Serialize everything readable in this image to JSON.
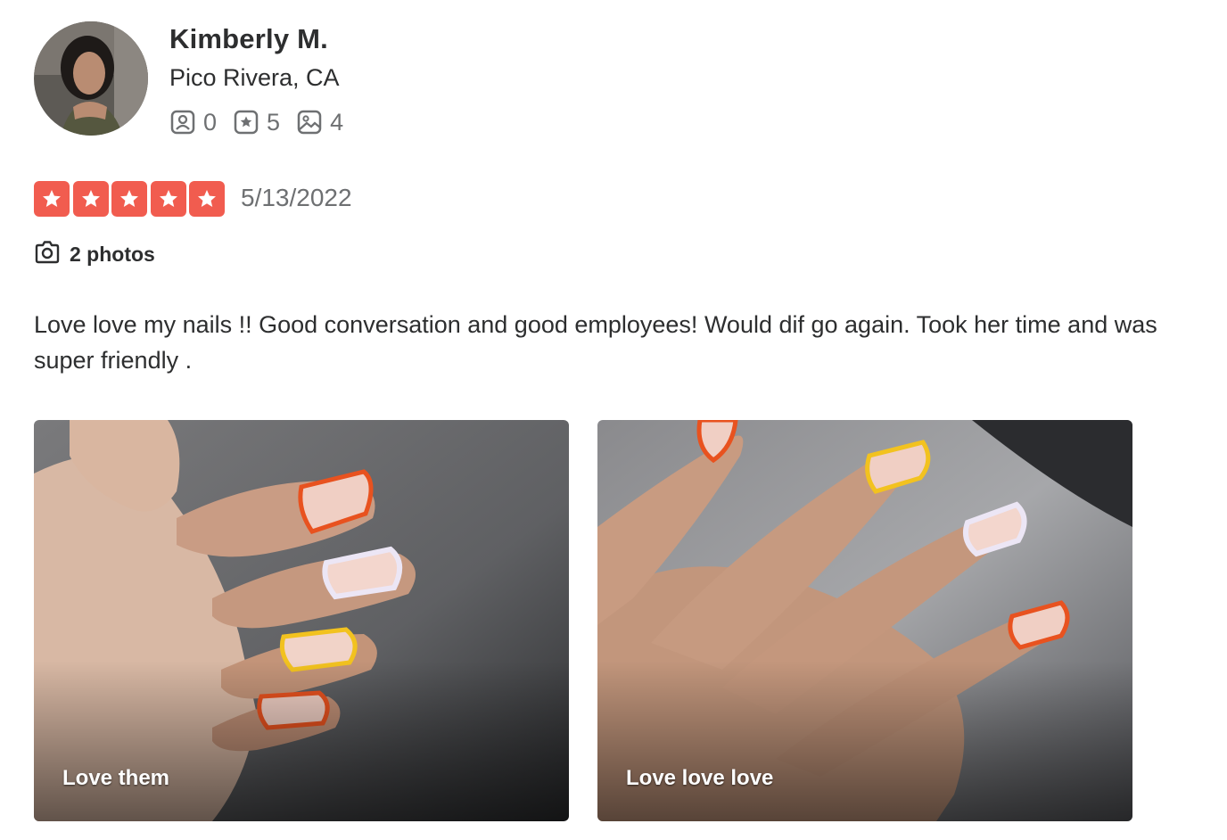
{
  "colors": {
    "star_red": "#f15c4f",
    "text_primary": "#2d2e2f",
    "text_secondary": "#6e7072"
  },
  "user": {
    "name": "Kimberly M.",
    "location": "Pico Rivera, CA",
    "stats": [
      {
        "icon": "friends-icon",
        "value": "0"
      },
      {
        "icon": "reviews-icon",
        "value": "5"
      },
      {
        "icon": "photos-icon",
        "value": "4"
      }
    ]
  },
  "review": {
    "rating": 5,
    "rating_max": 5,
    "date": "5/13/2022",
    "photos_link": "2 photos",
    "text": "Love love my nails !! Good conversation and good employees! Would dif go again. Took her time and was super friendly .",
    "photos": [
      {
        "caption": "Love them"
      },
      {
        "caption": "Love love love"
      }
    ]
  }
}
